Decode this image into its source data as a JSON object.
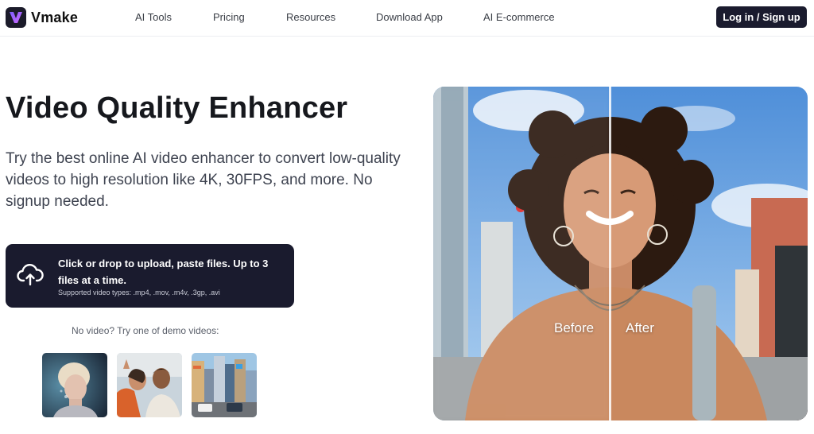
{
  "brand": {
    "name": "Vmake",
    "accent": "#1a1b2e",
    "logo_gradient": [
      "#7b5cff",
      "#c56bff"
    ]
  },
  "nav": {
    "items": [
      {
        "label": "AI Tools"
      },
      {
        "label": "Pricing"
      },
      {
        "label": "Resources"
      },
      {
        "label": "Download App"
      },
      {
        "label": "AI E-commerce"
      }
    ],
    "login_label": "Log in / Sign up"
  },
  "hero": {
    "title": "Video Quality Enhancer",
    "subtitle": "Try the best online AI video enhancer to convert low-quality videos to high resolution like 4K, 30FPS, and more. No signup needed."
  },
  "upload": {
    "icon": "cloud-upload-icon",
    "main_text": "Click or drop to upload, paste files. Up to 3 files at a time.",
    "sub_text": "Supported video types: .mp4, .mov, .m4v, .3gp, .avi"
  },
  "demo": {
    "label": "No video? Try one of demo videos:",
    "thumbnails": [
      {
        "subject": "blonde-woman-portrait"
      },
      {
        "subject": "two-friends-selfie"
      },
      {
        "subject": "city-street-scene"
      }
    ]
  },
  "comparison": {
    "before_label": "Before",
    "after_label": "After"
  }
}
